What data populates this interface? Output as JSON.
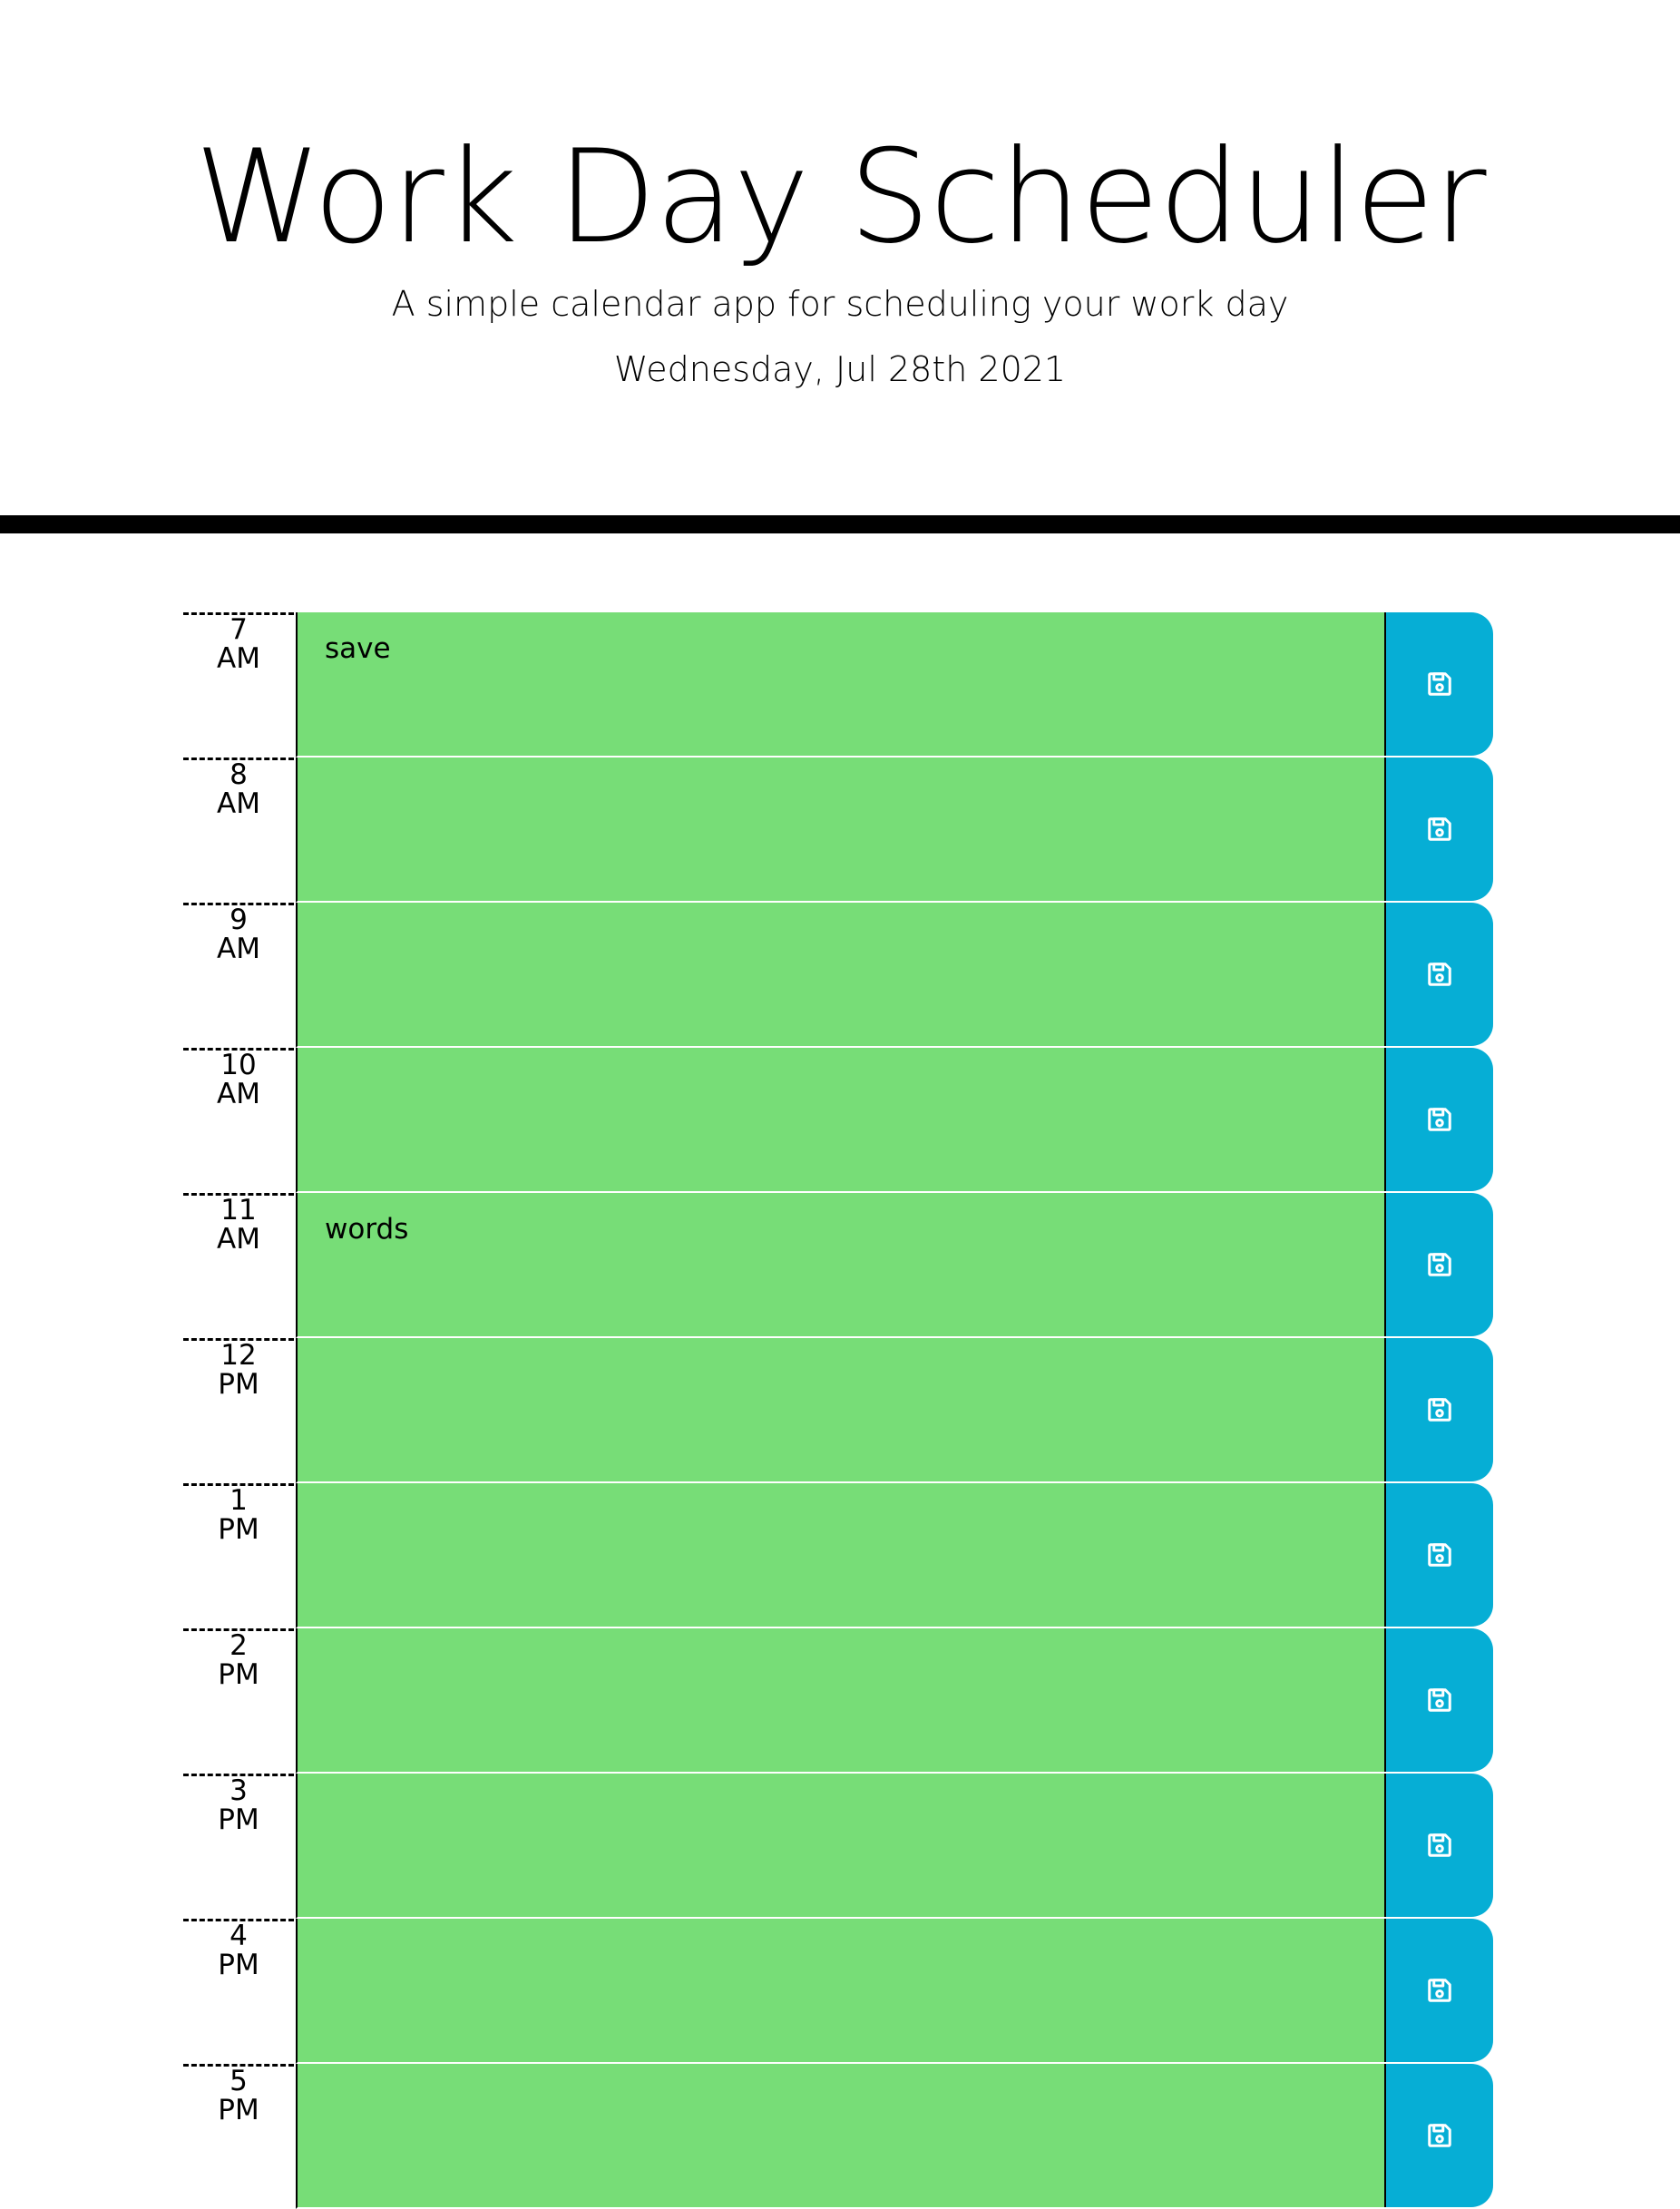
{
  "header": {
    "title": "Work Day Scheduler",
    "lead": "A simple calendar app for scheduling your work day",
    "current_day": "Wednesday, Jul 28th 2021"
  },
  "colors": {
    "present_or_future_block": "#77dd77",
    "save_button": "#06aed5",
    "header_border": "#000000"
  },
  "rows": [
    {
      "hour": "7",
      "period": "AM",
      "text": "save"
    },
    {
      "hour": "8",
      "period": "AM",
      "text": ""
    },
    {
      "hour": "9",
      "period": "AM",
      "text": ""
    },
    {
      "hour": "10",
      "period": "AM",
      "text": ""
    },
    {
      "hour": "11",
      "period": "AM",
      "text": "words"
    },
    {
      "hour": "12",
      "period": "PM",
      "text": ""
    },
    {
      "hour": "1",
      "period": "PM",
      "text": ""
    },
    {
      "hour": "2",
      "period": "PM",
      "text": ""
    },
    {
      "hour": "3",
      "period": "PM",
      "text": ""
    },
    {
      "hour": "4",
      "period": "PM",
      "text": ""
    },
    {
      "hour": "5",
      "period": "PM",
      "text": ""
    }
  ],
  "icons": {
    "save": "floppy-disk-icon"
  }
}
